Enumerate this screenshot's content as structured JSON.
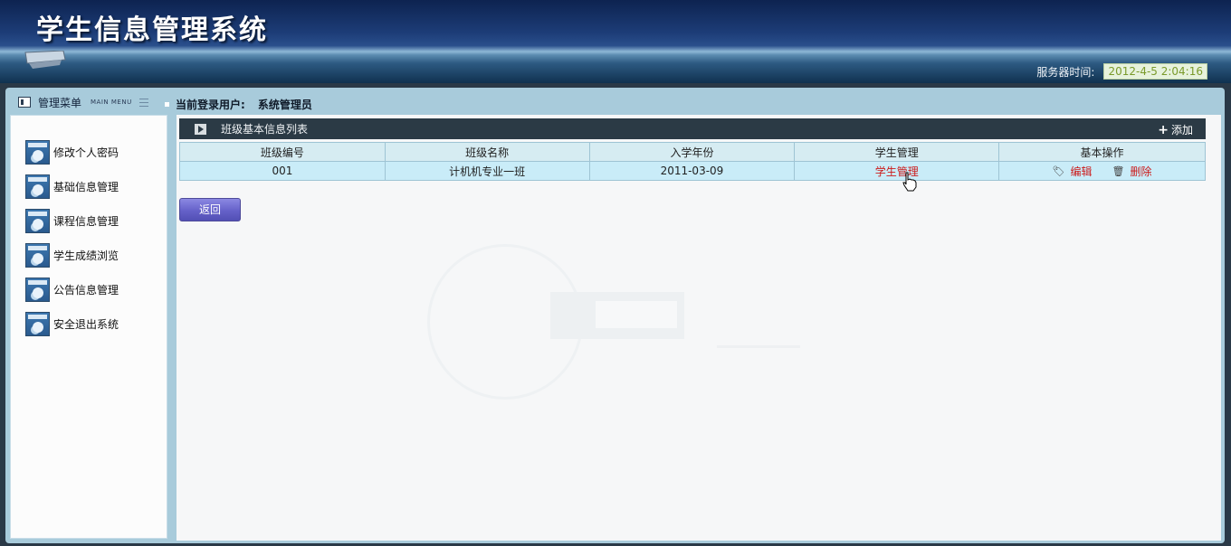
{
  "header": {
    "title": "学生信息管理系统",
    "server_time_label": "服务器时间:",
    "server_time_value": "2012-4-5 2:04:16"
  },
  "sidebar": {
    "title": "管理菜单",
    "subtitle": "MAIN MENU",
    "items": [
      {
        "label": "修改个人密码",
        "icon": "user-window-icon"
      },
      {
        "label": "基础信息管理",
        "icon": "user-window-icon"
      },
      {
        "label": "课程信息管理",
        "icon": "user-window-icon"
      },
      {
        "label": "学生成绩浏览",
        "icon": "user-window-icon"
      },
      {
        "label": "公告信息管理",
        "icon": "user-window-icon"
      },
      {
        "label": "安全退出系统",
        "icon": "user-window-icon"
      }
    ]
  },
  "user_bar": {
    "label": "当前登录用户:",
    "name": "系统管理员"
  },
  "list": {
    "title": "班级基本信息列表",
    "add_label": "添加",
    "columns": [
      "班级编号",
      "班级名称",
      "入学年份",
      "学生管理",
      "基本操作"
    ],
    "rows": [
      {
        "id": "001",
        "name": "计机机专业一班",
        "year": "2011-03-09",
        "student_link": "学生管理",
        "edit": "编辑",
        "delete": "删除"
      }
    ]
  },
  "back_label": "返回",
  "colors": {
    "header_dark": "#0d2350",
    "frame": "#a8cbdb",
    "table_header": "#d6ecf2",
    "table_row": "#c9ecf8",
    "link_red": "#cc1b1b",
    "button_purple": "#6561c9"
  }
}
